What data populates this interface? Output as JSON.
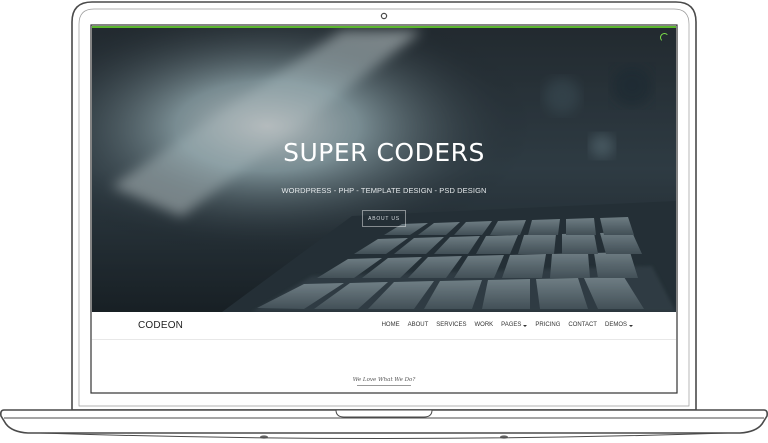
{
  "hero": {
    "title": "SUPER CODERS",
    "subtitle": "WORDPRESS - PHP - TEMPLATE DESIGN - PSD DESIGN",
    "button_label": "ABOUT US"
  },
  "navbar": {
    "brand": "CODEON",
    "items": [
      {
        "label": "HOME",
        "dropdown": false
      },
      {
        "label": "ABOUT",
        "dropdown": false
      },
      {
        "label": "SERVICES",
        "dropdown": false
      },
      {
        "label": "WORK",
        "dropdown": false
      },
      {
        "label": "PAGES",
        "dropdown": true
      },
      {
        "label": "PRICING",
        "dropdown": false
      },
      {
        "label": "CONTACT",
        "dropdown": false
      },
      {
        "label": "DEMOS",
        "dropdown": true
      }
    ]
  },
  "section": {
    "tagline": "We Love What We Do?"
  },
  "colors": {
    "accent": "#5cb82e",
    "laptop_outline": "#4a4a4a",
    "hero_overlay": "#1b2228"
  },
  "icons": {
    "loader": "spinner-icon",
    "dropdown": "caret-down-icon",
    "camera": "webcam-icon"
  }
}
